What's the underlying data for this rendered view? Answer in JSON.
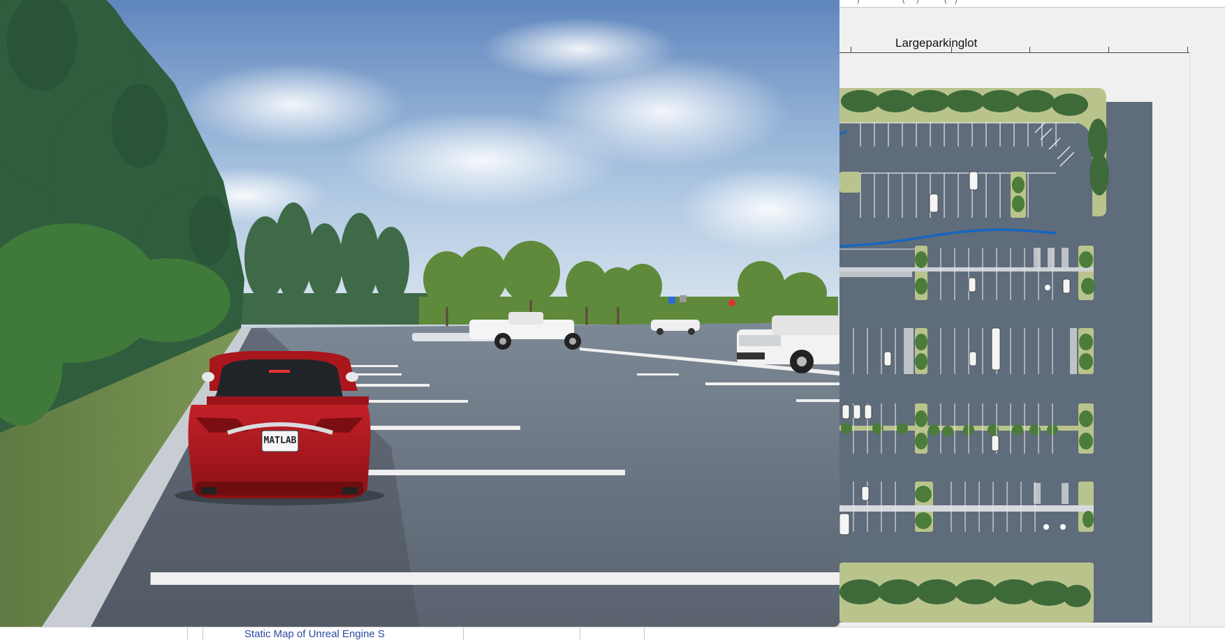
{
  "simulation_view": {
    "plate_text": "MATLAB"
  },
  "figure": {
    "title": "Largeparkinglot",
    "toolbar_fragments": [
      ")",
      "(",
      ")",
      "(",
      ")"
    ]
  },
  "background_window": {
    "link_text": "Static Map of Unreal Engine S"
  },
  "colors": {
    "asphalt": "#5d6b7a",
    "sky": "#9ab8d8",
    "path": "#1565c0",
    "car_red": "#b3191e"
  }
}
